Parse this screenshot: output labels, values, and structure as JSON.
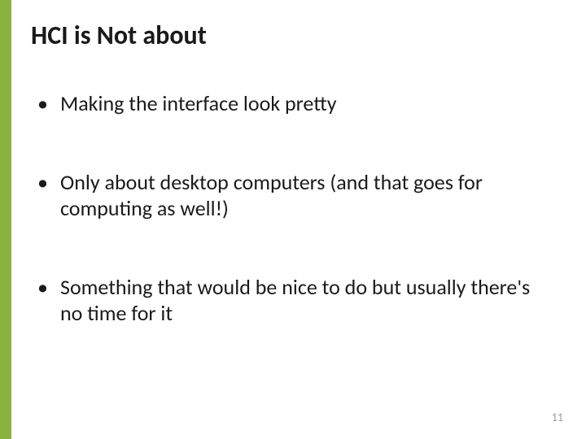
{
  "slide": {
    "title": "HCI is Not about",
    "bullets": [
      "Making the interface look pretty",
      "Only about desktop computers (and that goes for computing as well!)",
      "Something that would be nice to do but usually there's no time for it"
    ],
    "page_number": "11"
  }
}
